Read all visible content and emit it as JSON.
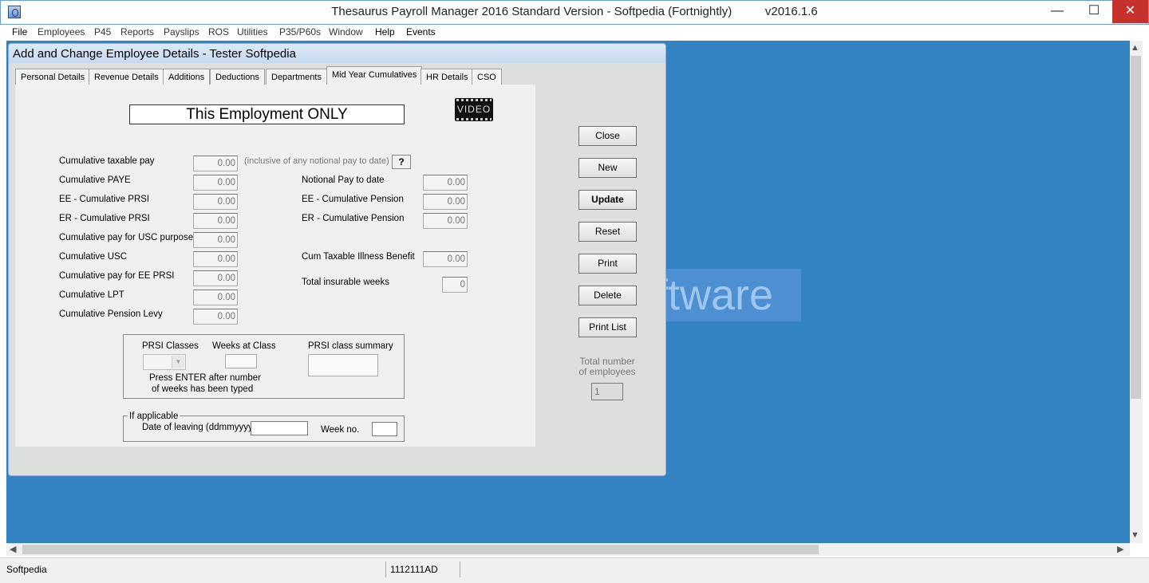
{
  "window": {
    "title": "Thesaurus Payroll Manager 2016 Standard Version - Softpedia (Fortnightly)          v2016.1.6",
    "minimize": "—",
    "maximize": "☐",
    "close": "✕"
  },
  "menu": [
    "File",
    "Employees",
    "P45",
    "Reports",
    "Payslips",
    "ROS",
    "Utilities",
    "P35/P60s",
    "Window",
    "Help",
    "Events"
  ],
  "background_watermark": "ftware",
  "dialog": {
    "title": "Add and Change Employee Details - Tester Softpedia",
    "tabs": [
      "Personal Details",
      "Revenue Details",
      "Additions",
      "Deductions",
      "Departments",
      "Mid Year Cumulatives",
      "HR Details",
      "CSO"
    ],
    "active_tab": "Mid Year Cumulatives",
    "heading": "This Employment ONLY",
    "video_label": "VIDEO",
    "left_fields": [
      {
        "label": "Cumulative taxable pay",
        "value": "0.00"
      },
      {
        "label": "Cumulative PAYE",
        "value": "0.00"
      },
      {
        "label": "EE - Cumulative PRSI",
        "value": "0.00"
      },
      {
        "label": "ER - Cumulative PRSI",
        "value": "0.00"
      },
      {
        "label": "Cumulative pay for USC purposes",
        "value": "0.00"
      },
      {
        "label": "Cumulative USC",
        "value": "0.00"
      },
      {
        "label": "Cumulative pay for EE PRSI",
        "value": "0.00"
      },
      {
        "label": "Cumulative LPT",
        "value": "0.00"
      },
      {
        "label": "Cumulative Pension Levy",
        "value": "0.00"
      }
    ],
    "taxable_note": "(inclusive of any notional pay to date)",
    "help_label": "?",
    "right_fields": [
      {
        "label": "Notional Pay to date",
        "value": "0.00"
      },
      {
        "label": "EE - Cumulative Pension",
        "value": "0.00"
      },
      {
        "label": "ER - Cumulative Pension",
        "value": "0.00"
      },
      {
        "label": "Cum Taxable Illness Benefit",
        "value": "0.00"
      }
    ],
    "insurable_weeks": {
      "label": "Total insurable weeks",
      "value": "0"
    },
    "prsi": {
      "classes_label": "PRSI Classes",
      "weeks_label": "Weeks at Class",
      "summary_label": "PRSI class summary",
      "hint_line1": "Press ENTER after number",
      "hint_line2": "of weeks has been typed",
      "class_value": "",
      "weeks_value": "",
      "summary_value": ""
    },
    "leaving": {
      "group_label": "If applicable",
      "date_label": "Date of leaving (ddmmyyyy)",
      "date_value": "",
      "week_label": "Week no.",
      "week_value": ""
    },
    "buttons": [
      "Close",
      "New",
      "Update",
      "Reset",
      "Print",
      "Delete",
      "Print List"
    ],
    "total_label_line1": "Total number",
    "total_label_line2": "of employees",
    "total_value": "1"
  },
  "status": {
    "left": "Softpedia",
    "middle": "1112111AD",
    "right": ""
  }
}
